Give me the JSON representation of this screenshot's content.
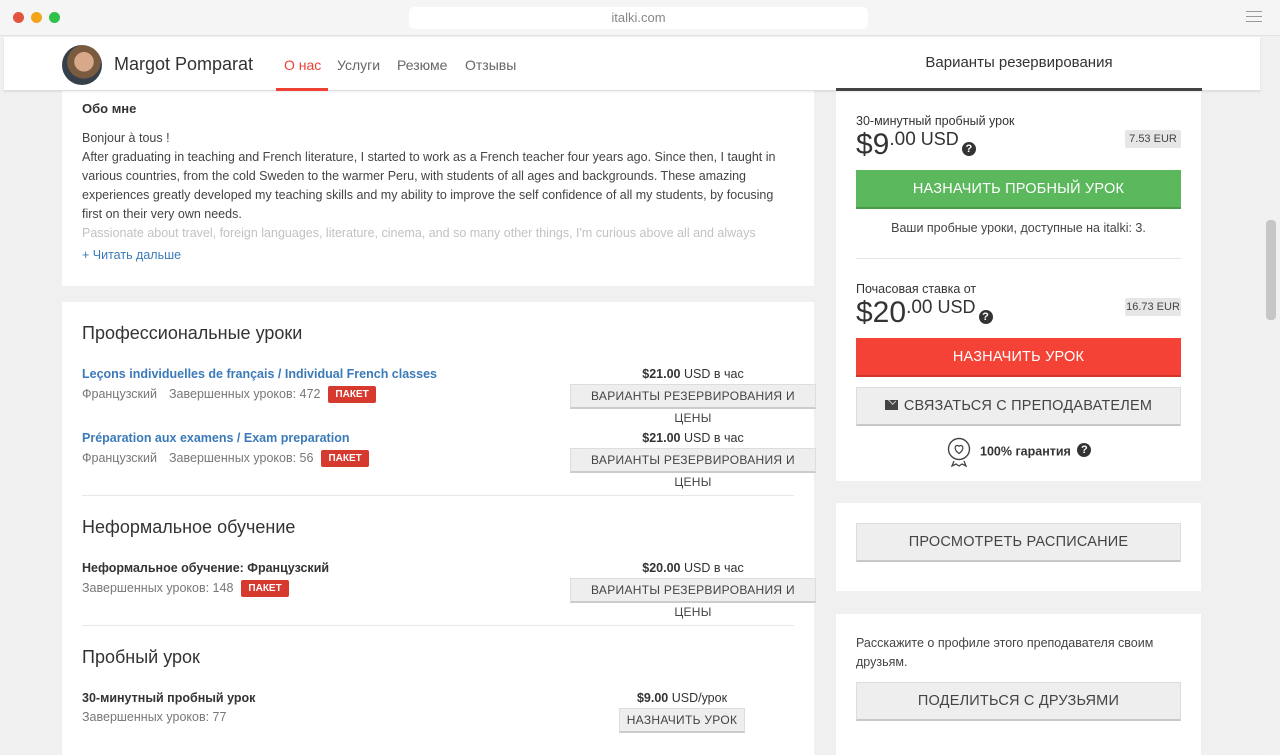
{
  "browser": {
    "url": "italki.com"
  },
  "header": {
    "teacher_name": "Margot Pomparat",
    "tabs": [
      "О нас",
      "Услуги",
      "Резюме",
      "Отзывы"
    ],
    "active_tab": "О нас",
    "booking_tab": "Варианты резервирования"
  },
  "about": {
    "title": "Обо мне",
    "lines": [
      "Bonjour à tous !",
      "After graduating in teaching and French literature, I started to work as a French teacher four years ago. Since then, I taught in various countries, from the cold Sweden to the warmer Peru, with students of all ages and backgrounds. These amazing experiences greatly developed my teaching skills and my ability to improve the self confidence of all my students, by focusing first on their very own needs.",
      "Passionate about travel, foreign languages, literature, cinema, and so many other things, I'm curious above all and always"
    ],
    "read_more": "+ Читать дальше"
  },
  "lessons": {
    "professional": {
      "title": "Профессиональные уроки",
      "items": [
        {
          "name": "Leçons individuelles de français / Individual French classes",
          "language": "Французский",
          "completed": "Завершенных уроков: 472",
          "badge": "ПАКЕТ",
          "price": "$21.00",
          "price_unit": "USD в час",
          "button": "ВАРИАНТЫ РЕЗЕРВИРОВАНИЯ И ЦЕНЫ"
        },
        {
          "name": "Préparation aux examens / Exam preparation",
          "language": "Французский",
          "completed": "Завершенных уроков: 56",
          "badge": "ПАКЕТ",
          "price": "$21.00",
          "price_unit": "USD в час",
          "button": "ВАРИАНТЫ РЕЗЕРВИРОВАНИЯ И ЦЕНЫ"
        }
      ]
    },
    "informal": {
      "title": "Неформальное обучение",
      "items": [
        {
          "name": "Неформальное обучение: Французский",
          "completed": "Завершенных уроков: 148",
          "badge": "ПАКЕТ",
          "price": "$20.00",
          "price_unit": "USD в час",
          "button": "ВАРИАНТЫ РЕЗЕРВИРОВАНИЯ И ЦЕНЫ"
        }
      ]
    },
    "trial": {
      "title": "Пробный урок",
      "items": [
        {
          "name": "30-минутный пробный урок",
          "completed": "Завершенных уроков: 77",
          "price": "$9.00",
          "price_unit": "USD/урок",
          "button": "НАЗНАЧИТЬ УРОК"
        }
      ]
    }
  },
  "booking": {
    "trial_label": "30-минутный пробный урок",
    "trial_price_main": "$9",
    "trial_price_cents": ".00",
    "currency": "USD",
    "trial_eur": "7.53 EUR",
    "trial_button": "НАЗНАЧИТЬ ПРОБНЫЙ УРОК",
    "trial_count": "Ваши пробные уроки, доступные на italki: 3.",
    "hourly_label": "Почасовая ставка от",
    "hourly_price_main": "$20",
    "hourly_price_cents": ".00",
    "hourly_eur": "16.73 EUR",
    "book_button": "НАЗНАЧИТЬ УРОК",
    "contact_button": "СВЯЗАТЬСЯ С ПРЕПОДАВАТЕЛЕМ",
    "guarantee": "100% гарантия"
  },
  "schedule": {
    "button": "ПРОСМОТРЕТЬ РАСПИСАНИЕ"
  },
  "share": {
    "text": "Расскажите о профиле этого преподавателя своим друзьям.",
    "button": "ПОДЕЛИТЬСЯ С ДРУЗЬЯМИ"
  },
  "colors": {
    "accent_red": "#ef4035",
    "green": "#5cb85c",
    "link_blue": "#3b7ab8",
    "badge_red": "#d63a2f"
  }
}
